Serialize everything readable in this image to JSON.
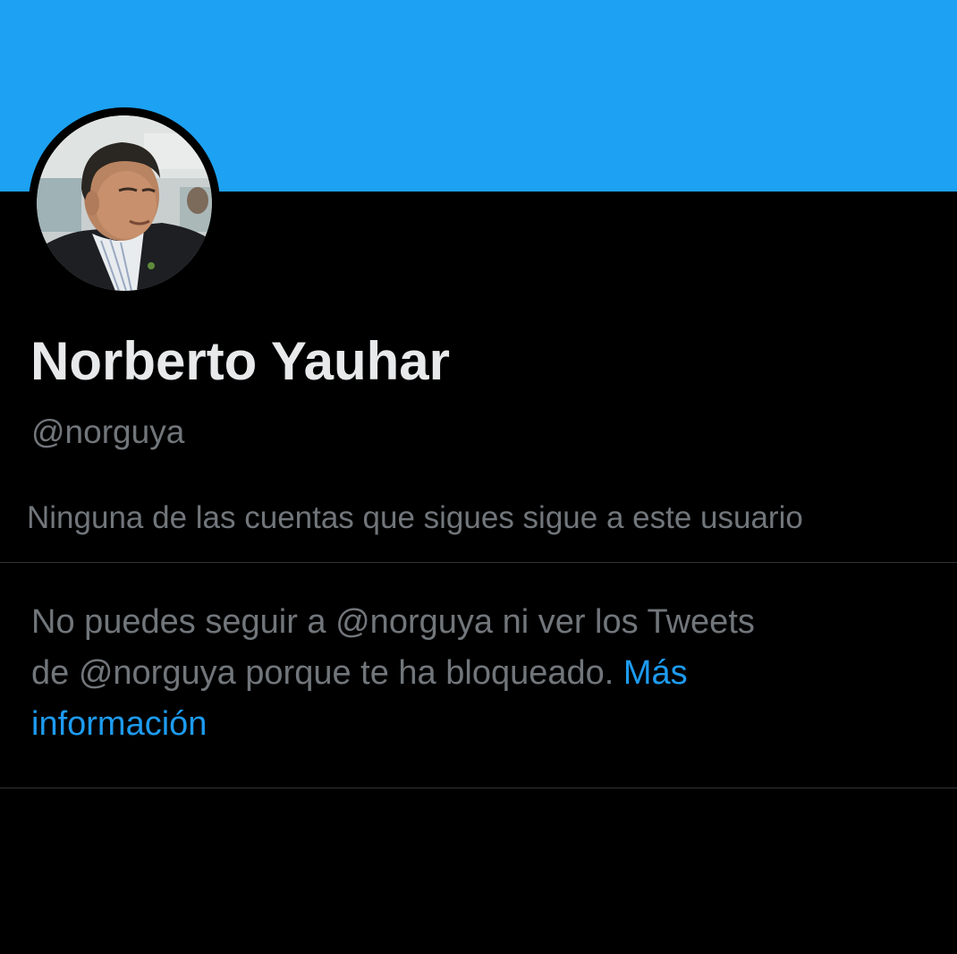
{
  "profile": {
    "display_name": "Norberto Yauhar",
    "handle": "@norguya",
    "followers_you_know": "Ninguna de las cuentas que sigues sigue a este usuario"
  },
  "blocked_notice": {
    "line1": "No puedes seguir a @norguya ni ver los Tweets",
    "line2_prefix": "de @norguya porque te ha bloqueado. ",
    "learn_more_line1": "Más",
    "learn_more_line2": "información"
  },
  "colors": {
    "banner": "#1d9bf0",
    "background": "#000000",
    "primary_text": "#e7e9ea",
    "secondary_text": "#71767b",
    "link": "#1d9bf0",
    "divider": "#2f3336"
  },
  "icons": {
    "avatar": "profile-photo"
  }
}
